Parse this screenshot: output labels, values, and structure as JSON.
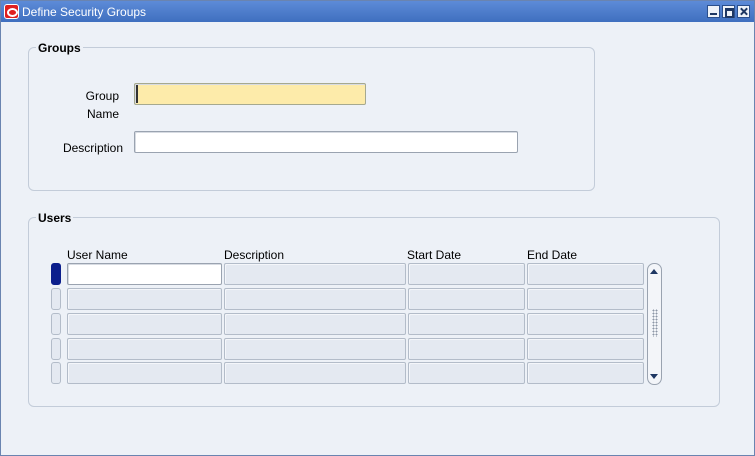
{
  "window": {
    "title": "Define Security Groups",
    "icon": "oracle-icon"
  },
  "groups_section": {
    "title": "Groups",
    "group_name_label_line1": "Group",
    "group_name_label_line2": "Name",
    "group_name_value": "",
    "description_label": "Description",
    "description_value": ""
  },
  "users_section": {
    "title": "Users",
    "columns": [
      "User Name",
      "Description",
      "Start Date",
      "End Date"
    ],
    "rows": [
      {
        "user_name": "",
        "description": "",
        "start_date": "",
        "end_date": ""
      },
      {
        "user_name": "",
        "description": "",
        "start_date": "",
        "end_date": ""
      },
      {
        "user_name": "",
        "description": "",
        "start_date": "",
        "end_date": ""
      },
      {
        "user_name": "",
        "description": "",
        "start_date": "",
        "end_date": ""
      },
      {
        "user_name": "",
        "description": "",
        "start_date": "",
        "end_date": ""
      }
    ]
  },
  "colors": {
    "titlebar": "#4a79c9",
    "required_field": "#fdebaa",
    "current_row_indicator": "#0b1e8c",
    "form_background": "#edf1f7"
  }
}
